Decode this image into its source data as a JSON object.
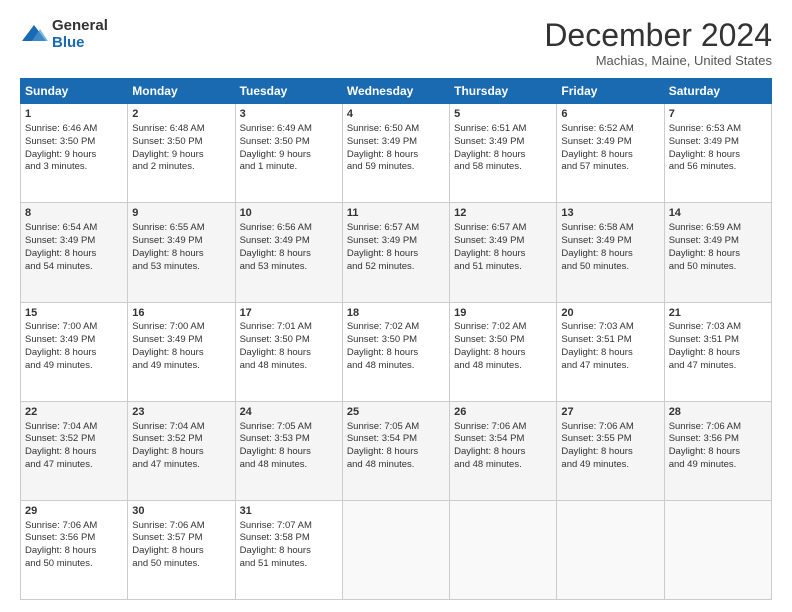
{
  "logo": {
    "general": "General",
    "blue": "Blue"
  },
  "title": "December 2024",
  "location": "Machias, Maine, United States",
  "days_of_week": [
    "Sunday",
    "Monday",
    "Tuesday",
    "Wednesday",
    "Thursday",
    "Friday",
    "Saturday"
  ],
  "weeks": [
    [
      {
        "day": "1",
        "lines": [
          "Sunrise: 6:46 AM",
          "Sunset: 3:50 PM",
          "Daylight: 9 hours",
          "and 3 minutes."
        ]
      },
      {
        "day": "2",
        "lines": [
          "Sunrise: 6:48 AM",
          "Sunset: 3:50 PM",
          "Daylight: 9 hours",
          "and 2 minutes."
        ]
      },
      {
        "day": "3",
        "lines": [
          "Sunrise: 6:49 AM",
          "Sunset: 3:50 PM",
          "Daylight: 9 hours",
          "and 1 minute."
        ]
      },
      {
        "day": "4",
        "lines": [
          "Sunrise: 6:50 AM",
          "Sunset: 3:49 PM",
          "Daylight: 8 hours",
          "and 59 minutes."
        ]
      },
      {
        "day": "5",
        "lines": [
          "Sunrise: 6:51 AM",
          "Sunset: 3:49 PM",
          "Daylight: 8 hours",
          "and 58 minutes."
        ]
      },
      {
        "day": "6",
        "lines": [
          "Sunrise: 6:52 AM",
          "Sunset: 3:49 PM",
          "Daylight: 8 hours",
          "and 57 minutes."
        ]
      },
      {
        "day": "7",
        "lines": [
          "Sunrise: 6:53 AM",
          "Sunset: 3:49 PM",
          "Daylight: 8 hours",
          "and 56 minutes."
        ]
      }
    ],
    [
      {
        "day": "8",
        "lines": [
          "Sunrise: 6:54 AM",
          "Sunset: 3:49 PM",
          "Daylight: 8 hours",
          "and 54 minutes."
        ]
      },
      {
        "day": "9",
        "lines": [
          "Sunrise: 6:55 AM",
          "Sunset: 3:49 PM",
          "Daylight: 8 hours",
          "and 53 minutes."
        ]
      },
      {
        "day": "10",
        "lines": [
          "Sunrise: 6:56 AM",
          "Sunset: 3:49 PM",
          "Daylight: 8 hours",
          "and 53 minutes."
        ]
      },
      {
        "day": "11",
        "lines": [
          "Sunrise: 6:57 AM",
          "Sunset: 3:49 PM",
          "Daylight: 8 hours",
          "and 52 minutes."
        ]
      },
      {
        "day": "12",
        "lines": [
          "Sunrise: 6:57 AM",
          "Sunset: 3:49 PM",
          "Daylight: 8 hours",
          "and 51 minutes."
        ]
      },
      {
        "day": "13",
        "lines": [
          "Sunrise: 6:58 AM",
          "Sunset: 3:49 PM",
          "Daylight: 8 hours",
          "and 50 minutes."
        ]
      },
      {
        "day": "14",
        "lines": [
          "Sunrise: 6:59 AM",
          "Sunset: 3:49 PM",
          "Daylight: 8 hours",
          "and 50 minutes."
        ]
      }
    ],
    [
      {
        "day": "15",
        "lines": [
          "Sunrise: 7:00 AM",
          "Sunset: 3:49 PM",
          "Daylight: 8 hours",
          "and 49 minutes."
        ]
      },
      {
        "day": "16",
        "lines": [
          "Sunrise: 7:00 AM",
          "Sunset: 3:49 PM",
          "Daylight: 8 hours",
          "and 49 minutes."
        ]
      },
      {
        "day": "17",
        "lines": [
          "Sunrise: 7:01 AM",
          "Sunset: 3:50 PM",
          "Daylight: 8 hours",
          "and 48 minutes."
        ]
      },
      {
        "day": "18",
        "lines": [
          "Sunrise: 7:02 AM",
          "Sunset: 3:50 PM",
          "Daylight: 8 hours",
          "and 48 minutes."
        ]
      },
      {
        "day": "19",
        "lines": [
          "Sunrise: 7:02 AM",
          "Sunset: 3:50 PM",
          "Daylight: 8 hours",
          "and 48 minutes."
        ]
      },
      {
        "day": "20",
        "lines": [
          "Sunrise: 7:03 AM",
          "Sunset: 3:51 PM",
          "Daylight: 8 hours",
          "and 47 minutes."
        ]
      },
      {
        "day": "21",
        "lines": [
          "Sunrise: 7:03 AM",
          "Sunset: 3:51 PM",
          "Daylight: 8 hours",
          "and 47 minutes."
        ]
      }
    ],
    [
      {
        "day": "22",
        "lines": [
          "Sunrise: 7:04 AM",
          "Sunset: 3:52 PM",
          "Daylight: 8 hours",
          "and 47 minutes."
        ]
      },
      {
        "day": "23",
        "lines": [
          "Sunrise: 7:04 AM",
          "Sunset: 3:52 PM",
          "Daylight: 8 hours",
          "and 47 minutes."
        ]
      },
      {
        "day": "24",
        "lines": [
          "Sunrise: 7:05 AM",
          "Sunset: 3:53 PM",
          "Daylight: 8 hours",
          "and 48 minutes."
        ]
      },
      {
        "day": "25",
        "lines": [
          "Sunrise: 7:05 AM",
          "Sunset: 3:54 PM",
          "Daylight: 8 hours",
          "and 48 minutes."
        ]
      },
      {
        "day": "26",
        "lines": [
          "Sunrise: 7:06 AM",
          "Sunset: 3:54 PM",
          "Daylight: 8 hours",
          "and 48 minutes."
        ]
      },
      {
        "day": "27",
        "lines": [
          "Sunrise: 7:06 AM",
          "Sunset: 3:55 PM",
          "Daylight: 8 hours",
          "and 49 minutes."
        ]
      },
      {
        "day": "28",
        "lines": [
          "Sunrise: 7:06 AM",
          "Sunset: 3:56 PM",
          "Daylight: 8 hours",
          "and 49 minutes."
        ]
      }
    ],
    [
      {
        "day": "29",
        "lines": [
          "Sunrise: 7:06 AM",
          "Sunset: 3:56 PM",
          "Daylight: 8 hours",
          "and 50 minutes."
        ]
      },
      {
        "day": "30",
        "lines": [
          "Sunrise: 7:06 AM",
          "Sunset: 3:57 PM",
          "Daylight: 8 hours",
          "and 50 minutes."
        ]
      },
      {
        "day": "31",
        "lines": [
          "Sunrise: 7:07 AM",
          "Sunset: 3:58 PM",
          "Daylight: 8 hours",
          "and 51 minutes."
        ]
      },
      {
        "day": "",
        "lines": []
      },
      {
        "day": "",
        "lines": []
      },
      {
        "day": "",
        "lines": []
      },
      {
        "day": "",
        "lines": []
      }
    ]
  ]
}
